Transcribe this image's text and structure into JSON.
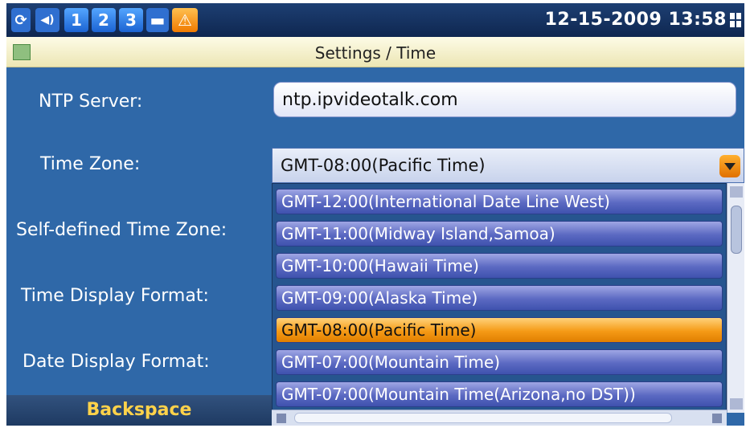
{
  "status_bar": {
    "line_keys": [
      "1",
      "2",
      "3"
    ],
    "datetime": "12-15-2009 13:58",
    "icons": [
      "refresh-icon",
      "speaker-icon",
      "folder-icon",
      "alert-icon",
      "signal-icon"
    ]
  },
  "title": "Settings / Time",
  "form": {
    "ntp_label": "NTP Server:",
    "ntp_value": "ntp.ipvideotalk.com",
    "timezone_label": "Time Zone:",
    "timezone_selected": "GMT-08:00(Pacific Time)",
    "self_tz_label": "Self-defined Time Zone:",
    "time_format_label": "Time Display Format:",
    "date_format_label": "Date Display Format:"
  },
  "timezone_options": [
    "GMT-12:00(International Date Line West)",
    "GMT-11:00(Midway Island,Samoa)",
    "GMT-10:00(Hawaii Time)",
    "GMT-09:00(Alaska Time)",
    "GMT-08:00(Pacific Time)",
    "GMT-07:00(Mountain Time)",
    "GMT-07:00(Mountain Time(Arizona,no DST))"
  ],
  "softkey": {
    "label": "Backspace"
  },
  "colors": {
    "accent": "#f59a16",
    "background": "#2f68a8",
    "softkey_text": "#ffd24a"
  }
}
